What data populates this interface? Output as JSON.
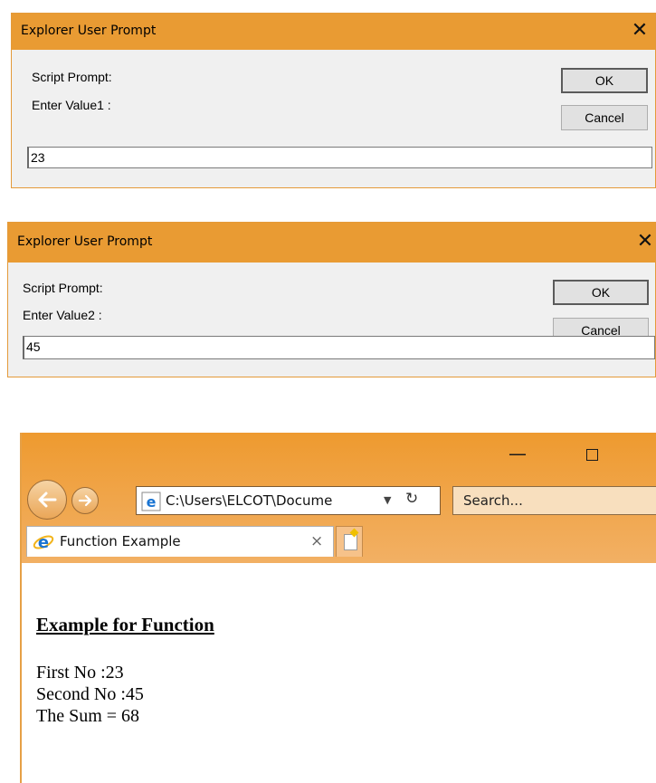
{
  "dialog1": {
    "title": "Explorer User Prompt",
    "close_glyph": "✕",
    "label_script": "Script Prompt:",
    "label_prompt": "Enter Value1 :",
    "ok": "OK",
    "cancel": "Cancel",
    "value": "23"
  },
  "dialog2": {
    "title": "Explorer User Prompt",
    "close_glyph": "✕",
    "label_script": "Script Prompt:",
    "label_prompt": "Enter Value2 :",
    "ok": "OK",
    "cancel": "Cancel",
    "value": "45"
  },
  "browser": {
    "minimize_glyph": "—",
    "address": "C:\\Users\\ELCOT\\Docume",
    "dropdown_glyph": "▼",
    "refresh_glyph": "↻",
    "search_placeholder": "Search...",
    "tab_title": "Function Example",
    "tab_close_glyph": "×"
  },
  "page": {
    "heading": "Example for Function",
    "line1": "First No :23",
    "line2": "Second No :45",
    "line3": "The Sum = 68"
  },
  "colors": {
    "titlebar": "#e99b33",
    "chrome": "#ee9a2f",
    "dialog_bg": "#f0f0f0"
  }
}
